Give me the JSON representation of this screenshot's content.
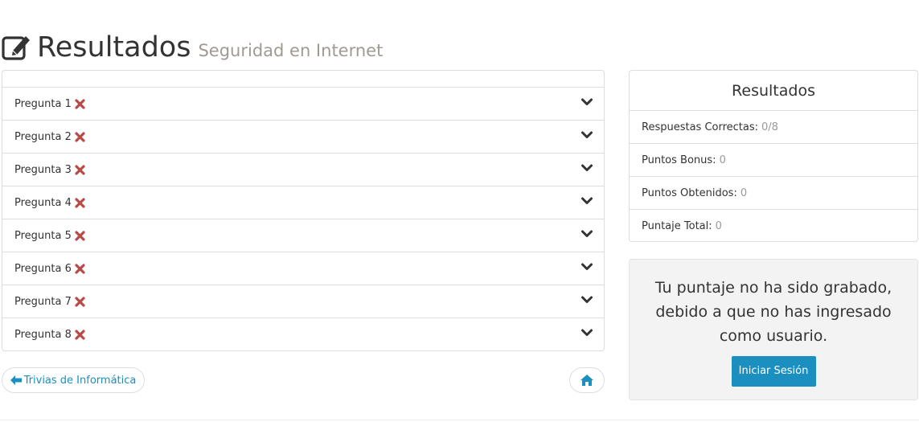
{
  "header": {
    "title": "Resultados",
    "subtitle": "Seguridad en Internet",
    "icon": "edit-icon"
  },
  "questions": [
    {
      "label": "Pregunta 1",
      "status": "incorrect"
    },
    {
      "label": "Pregunta 2",
      "status": "incorrect"
    },
    {
      "label": "Pregunta 3",
      "status": "incorrect"
    },
    {
      "label": "Pregunta 4",
      "status": "incorrect"
    },
    {
      "label": "Pregunta 5",
      "status": "incorrect"
    },
    {
      "label": "Pregunta 6",
      "status": "incorrect"
    },
    {
      "label": "Pregunta 7",
      "status": "incorrect"
    },
    {
      "label": "Pregunta 8",
      "status": "incorrect"
    }
  ],
  "results": {
    "title": "Resultados",
    "rows": [
      {
        "label": "Respuestas Correctas:",
        "value": "0/8"
      },
      {
        "label": "Puntos Bonus:",
        "value": "0"
      },
      {
        "label": "Puntos Obtenidos:",
        "value": "0"
      },
      {
        "label": "Puntaje Total:",
        "value": "0"
      }
    ]
  },
  "notice": {
    "text": "Tu puntaje no ha sido grabado, debido a que no has ingresado como usuario.",
    "login_label": "Iniciar Sesión"
  },
  "nav": {
    "back_label": "Trivias de Informática",
    "home_icon": "home-icon"
  },
  "colors": {
    "accent": "#1a8fc0",
    "incorrect": "#b94a48",
    "muted": "#999999"
  }
}
